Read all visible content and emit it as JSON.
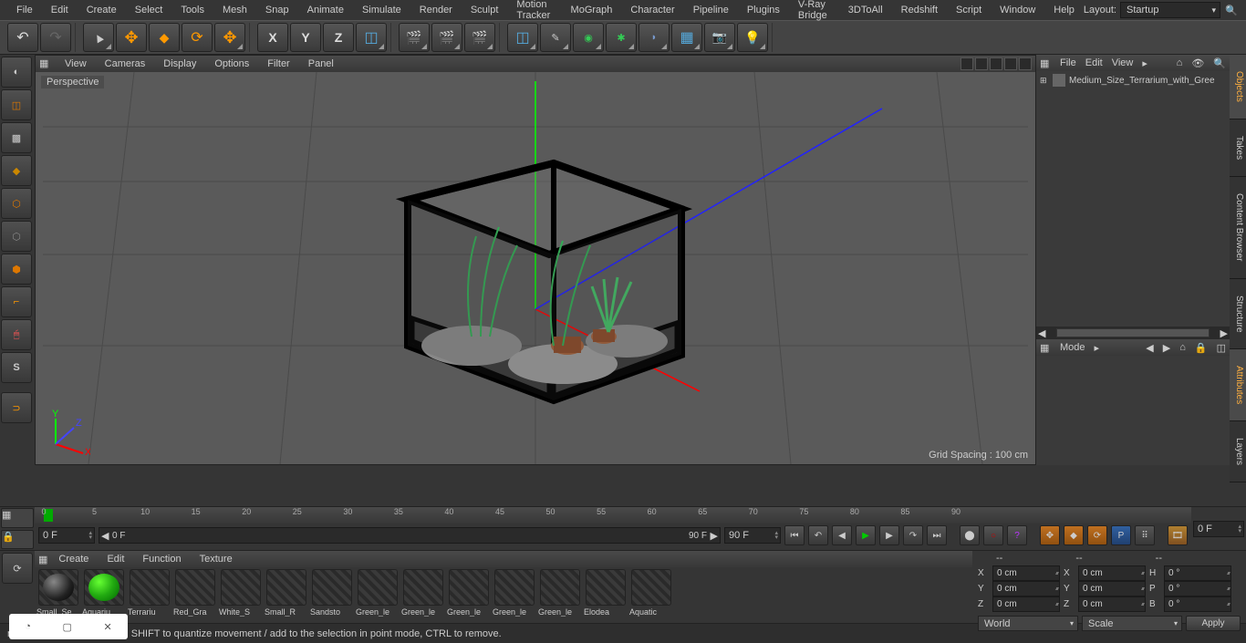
{
  "menubar": {
    "items": [
      "File",
      "Edit",
      "Create",
      "Select",
      "Tools",
      "Mesh",
      "Snap",
      "Animate",
      "Simulate",
      "Render",
      "Sculpt",
      "Motion Tracker",
      "MoGraph",
      "Character",
      "Pipeline",
      "Plugins",
      "V-Ray Bridge",
      "3DToAll",
      "Redshift",
      "Script",
      "Window",
      "Help"
    ],
    "layout_label": "Layout:",
    "layout_value": "Startup"
  },
  "toolbar": {
    "groups": [
      [
        "undo",
        "redo"
      ],
      [
        "cursor",
        "move",
        "scale",
        "rotate",
        "transform"
      ],
      [
        "axis-x",
        "axis-y",
        "axis-z",
        "coord-sys"
      ],
      [
        "render-pv",
        "render-region",
        "render-settings"
      ],
      [
        "add-cube",
        "add-spline",
        "add-generator",
        "add-deform",
        "add-env",
        "add-floor",
        "add-camera",
        "add-light"
      ]
    ]
  },
  "left_tools": [
    "make-editable",
    "model",
    "texture-mode",
    "workplane",
    "point",
    "edge",
    "poly",
    "axis-tool",
    "tweak",
    "magnet",
    "snap-toggle",
    "locked"
  ],
  "viewport": {
    "menus": [
      "View",
      "Cameras",
      "Display",
      "Options",
      "Filter",
      "Panel"
    ],
    "label": "Perspective",
    "grid_info": "Grid Spacing : 100 cm"
  },
  "right": {
    "obj_menus": [
      "File",
      "Edit",
      "View"
    ],
    "tree_item": "Medium_Size_Terrarium_with_Gree",
    "attr_mode": "Mode",
    "tabs": [
      "Objects",
      "Takes",
      "Content Browser",
      "Structure",
      "Attributes",
      "Layers"
    ]
  },
  "timeline": {
    "ticks": [
      "0",
      "5",
      "10",
      "15",
      "20",
      "25",
      "30",
      "35",
      "40",
      "45",
      "50",
      "55",
      "60",
      "65",
      "70",
      "75",
      "80",
      "85",
      "90"
    ],
    "start": "0 F",
    "range_left": "0 F",
    "range_right": "90 F",
    "end": "90 F",
    "cur": "0 F"
  },
  "materials": {
    "menus": [
      "Create",
      "Edit",
      "Function",
      "Texture"
    ],
    "items": [
      {
        "name": "Small_Se",
        "preview": "sphere-dark"
      },
      {
        "name": "Aquariu",
        "preview": "sphere-green"
      },
      {
        "name": "Terrariu",
        "preview": "checker"
      },
      {
        "name": "Red_Gra",
        "preview": "checker"
      },
      {
        "name": "White_S",
        "preview": "checker"
      },
      {
        "name": "Small_R",
        "preview": "checker"
      },
      {
        "name": "Sandsto",
        "preview": "checker"
      },
      {
        "name": "Green_le",
        "preview": "checker"
      },
      {
        "name": "Green_le",
        "preview": "checker"
      },
      {
        "name": "Green_le",
        "preview": "checker"
      },
      {
        "name": "Green_le",
        "preview": "checker"
      },
      {
        "name": "Green_le",
        "preview": "checker"
      },
      {
        "name": "Elodea",
        "preview": "checker"
      },
      {
        "name": "Aquatic",
        "preview": "checker"
      }
    ]
  },
  "coords": {
    "hdr": [
      "--",
      "--",
      "--"
    ],
    "rows": [
      {
        "a": "X",
        "p": "0 cm",
        "sa": "X",
        "s": "0 cm",
        "ra": "H",
        "r": "0 °"
      },
      {
        "a": "Y",
        "p": "0 cm",
        "sa": "Y",
        "s": "0 cm",
        "ra": "P",
        "r": "0 °"
      },
      {
        "a": "Z",
        "p": "0 cm",
        "sa": "Z",
        "s": "0 cm",
        "ra": "B",
        "r": "0 °"
      }
    ],
    "system": "World",
    "mode": "Scale",
    "apply": "Apply"
  },
  "status": "move elements. Hold down SHIFT to quantize movement / add to the selection in point mode, CTRL to remove."
}
